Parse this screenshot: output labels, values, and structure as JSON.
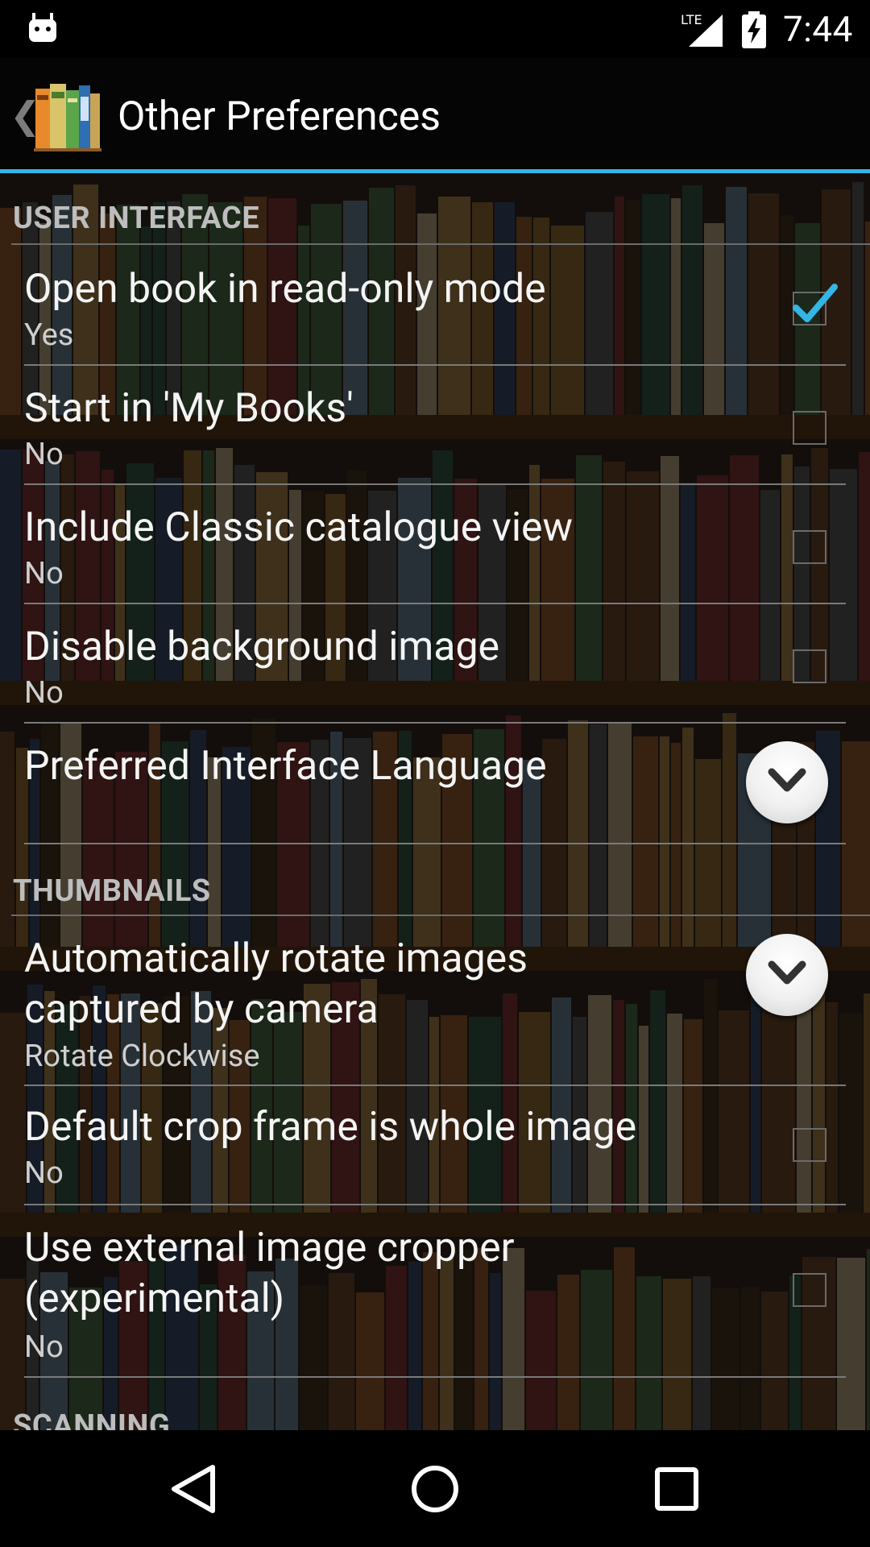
{
  "status_bar": {
    "network": "LTE",
    "time": "7:44"
  },
  "action_bar": {
    "up_caret": "❮",
    "title": "Other Preferences"
  },
  "sections": [
    {
      "label": "USER INTERFACE",
      "items": [
        {
          "title": "Open book in read-only mode",
          "summary": "Yes",
          "widget": "checkbox",
          "checked": true
        },
        {
          "title": "Start in 'My Books'",
          "summary": "No",
          "widget": "checkbox",
          "checked": false
        },
        {
          "title": "Include Classic catalogue view",
          "summary": "No",
          "widget": "checkbox",
          "checked": false
        },
        {
          "title": "Disable background image",
          "summary": "No",
          "widget": "checkbox",
          "checked": false
        },
        {
          "title": "Preferred Interface Language",
          "summary": "",
          "widget": "dropdown"
        }
      ]
    },
    {
      "label": "THUMBNAILS",
      "items": [
        {
          "title": "Automatically rotate images captured by camera",
          "summary": "Rotate Clockwise",
          "widget": "dropdown"
        },
        {
          "title": "Default crop frame is whole image",
          "summary": "No",
          "widget": "checkbox",
          "checked": false
        },
        {
          "title": "Use external image cropper (experimental)",
          "summary": "No",
          "widget": "checkbox",
          "checked": false
        }
      ]
    },
    {
      "label": "SCANNING",
      "items": []
    }
  ],
  "colors": {
    "accent": "#33b5e5",
    "check": "#33b5e5"
  }
}
